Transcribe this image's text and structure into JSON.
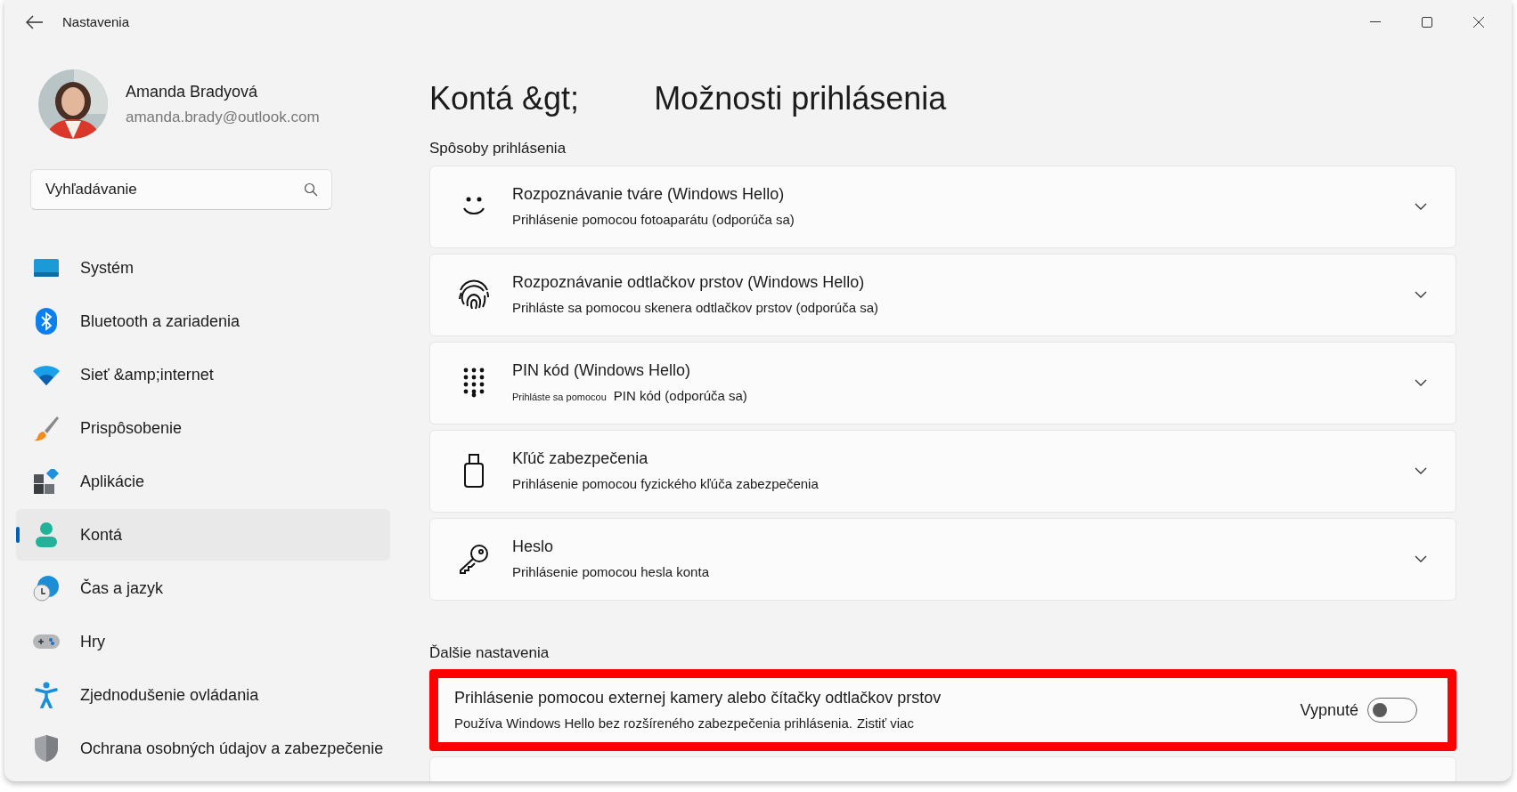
{
  "window": {
    "title": "Nastavenia"
  },
  "profile": {
    "name": "Amanda Bradyová",
    "email": "amanda.brady@outlook.com"
  },
  "search": {
    "placeholder": "Vyhľadávanie"
  },
  "nav": [
    {
      "label": "Systém",
      "selected": false
    },
    {
      "label": "Bluetooth a zariadenia",
      "selected": false
    },
    {
      "label": "Sieť &amp;internet",
      "selected": false
    },
    {
      "label": "Prispôsobenie",
      "selected": false
    },
    {
      "label": "Aplikácie",
      "selected": false
    },
    {
      "label": "Kontá",
      "selected": true
    },
    {
      "label": "Čas a jazyk",
      "selected": false
    },
    {
      "label": "Hry",
      "selected": false
    },
    {
      "label": "Zjednodušenie ovládania",
      "selected": false
    },
    {
      "label": "Ochrana osobných údajov a zabezpečenie",
      "selected": false
    }
  ],
  "breadcrumb": {
    "parent": "Kontá &gt;",
    "current": "Možnosti prihlásenia"
  },
  "sections": [
    {
      "title": "Spôsoby prihlásenia",
      "items": [
        {
          "kind": "expander",
          "title": "Rozpoznávanie tváre (Windows Hello)",
          "subtitle": "Prihlásenie pomocou fotoaparátu (odporúča sa)"
        },
        {
          "kind": "expander",
          "title": "Rozpoznávanie odtlačkov prstov (Windows Hello)",
          "subtitle": "Prihláste sa pomocou skenera odtlačkov prstov (odporúča sa)"
        },
        {
          "kind": "expander",
          "title": "PIN kód (Windows Hello)",
          "subtitle_small": "Prihláste sa pomocou",
          "subtitle": "PIN kód (odporúča sa)"
        },
        {
          "kind": "expander",
          "title": "Kľúč zabezpečenia",
          "subtitle": "Prihlásenie pomocou fyzického kľúča zabezpečenia"
        },
        {
          "kind": "expander",
          "title": "Heslo",
          "subtitle": "Prihlásenie pomocou hesla konta"
        }
      ]
    },
    {
      "title": "Ďalšie nastavenia",
      "items": [
        {
          "kind": "toggle",
          "title": "Prihlásenie pomocou externej kamery alebo čítačky odtlačkov prstov",
          "subtitle": "Používa Windows Hello bez rozšíreného zabezpečenia prihlásenia.",
          "link": "Zistiť viac",
          "state_label": "Vypnuté",
          "on": false,
          "highlighted": true
        },
        {
          "kind": "empty"
        }
      ]
    }
  ]
}
